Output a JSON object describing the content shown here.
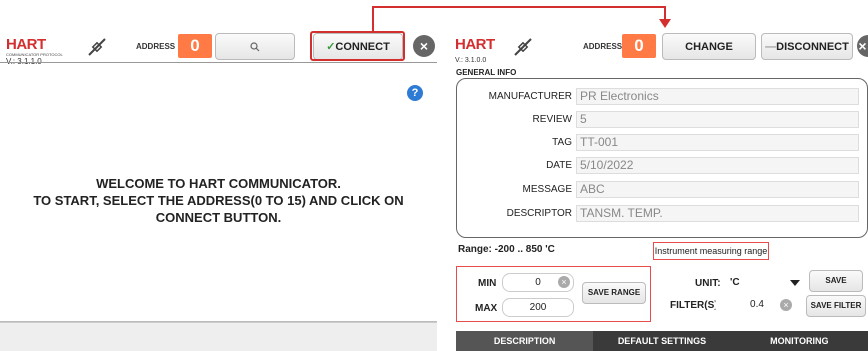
{
  "left": {
    "logo": "HART",
    "logo_sub": "COMMUNICATOR PROTOCOL",
    "version": "V.: 3.1.1.0",
    "address_label": "ADDRESS",
    "address_value": "0",
    "connect_label": "CONNECT",
    "welcome_line1": "WELCOME TO HART COMMUNICATOR.",
    "welcome_line2": "TO START, SELECT THE ADDRESS(0 TO 15) AND CLICK ON",
    "welcome_line3": "CONNECT BUTTON."
  },
  "right": {
    "logo": "HART",
    "version": "V.: 3.1.0.0",
    "address_label": "ADDRESS",
    "address_value": "0",
    "change_label": "CHANGE",
    "disconnect_label": "DISCONNECT",
    "general_info_title": "GENERAL INFO",
    "fields": [
      {
        "label": "MANUFACTURER",
        "value": "PR Electronics"
      },
      {
        "label": "REVIEW",
        "value": "5"
      },
      {
        "label": "TAG",
        "value": "TT-001"
      },
      {
        "label": "DATE",
        "value": "5/10/2022"
      },
      {
        "label": "MESSAGE",
        "value": "ABC"
      },
      {
        "label": "DESCRIPTOR",
        "value": "TANSM. TEMP."
      }
    ],
    "range_title": "Range: -200 .. 850 'C",
    "instrument_label": "Instrument measuring range",
    "min_label": "MIN",
    "min_value": "0",
    "max_label": "MAX",
    "max_value": "200",
    "save_range_label": "SAVE RANGE",
    "unit_label": "UNIT:",
    "unit_value": "'C",
    "save_label": "SAVE",
    "filter_label": "FILTER(S)",
    "filter_value": "0.4",
    "save_filter_label": "SAVE FILTER",
    "tabs": [
      "DESCRIPTION",
      "DEFAULT SETTINGS",
      "MONITORING"
    ]
  },
  "colors": {
    "accent_red": "#d32f2f",
    "address_orange": "#ff7a45",
    "help_blue": "#2e7bd6",
    "tabbar_dark": "#3a3a3a"
  },
  "icons": [
    "probe-icon",
    "search-icon",
    "check-icon",
    "close-icon",
    "help-icon",
    "clear-icon",
    "chevron-down-icon"
  ]
}
